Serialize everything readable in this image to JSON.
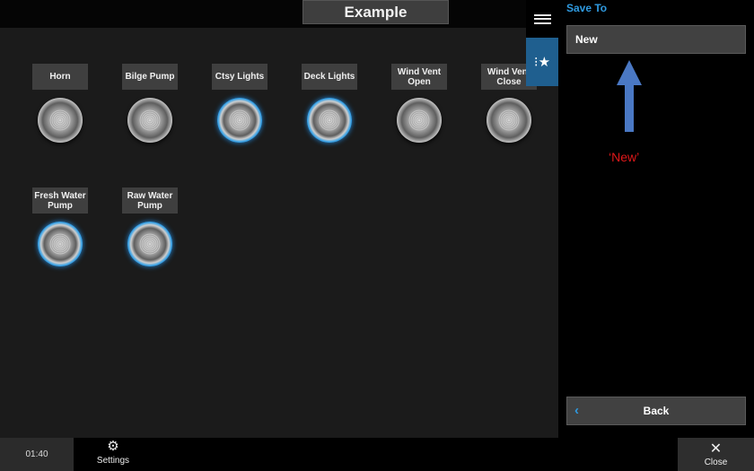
{
  "header": {
    "title": "Example"
  },
  "switches": [
    {
      "label": "Horn",
      "state": "off"
    },
    {
      "label": "Bilge Pump",
      "state": "off"
    },
    {
      "label": "Ctsy Lights",
      "state": "on"
    },
    {
      "label": "Deck Lights",
      "state": "on"
    },
    {
      "label": "Wind Vent\nOpen",
      "state": "off"
    },
    {
      "label": "Wind Vent\nClose",
      "state": "off"
    },
    {
      "label": "Fresh Water\nPump",
      "state": "on"
    },
    {
      "label": "Raw Water\nPump",
      "state": "on"
    }
  ],
  "side_tabs": {
    "menu_icon": "hamburger-menu-icon",
    "favorites_icon": "favorites-star-icon"
  },
  "panel": {
    "heading": "Save To",
    "option_new": "New",
    "annotation": "‘New’",
    "back_label": "Back"
  },
  "bottom": {
    "clock": "01:40",
    "settings_label": "Settings",
    "close_label": "Close"
  },
  "colors": {
    "accent_blue": "#2f9ae0",
    "active_tab": "#1f5f8f",
    "annotation_red": "#e0181a",
    "arrow_blue": "#4a78c4"
  }
}
